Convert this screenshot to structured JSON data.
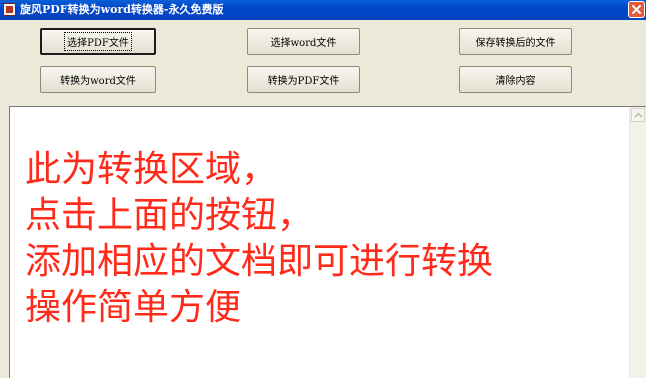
{
  "window": {
    "title": "旋风PDF转换为word转换器-永久免费版",
    "app_icon": "pdf-app-icon",
    "close_icon": "close-icon"
  },
  "toolbar": {
    "select_pdf": "选择PDF文件",
    "select_word": "选择word文件",
    "save_converted": "保存转换后的文件",
    "convert_to_word": "转换为word文件",
    "convert_to_pdf": "转换为PDF文件",
    "clear_content": "清除内容"
  },
  "content": {
    "lines": [
      "此为转换区域，",
      "点击上面的按钮，",
      "添加相应的文档即可进行转换",
      "操作简单方便"
    ],
    "text_color": "#ff2a1a"
  },
  "colors": {
    "titlebar": "#0046c9",
    "window_bg": "#ece9d8",
    "close_button": "#e25b3a"
  }
}
